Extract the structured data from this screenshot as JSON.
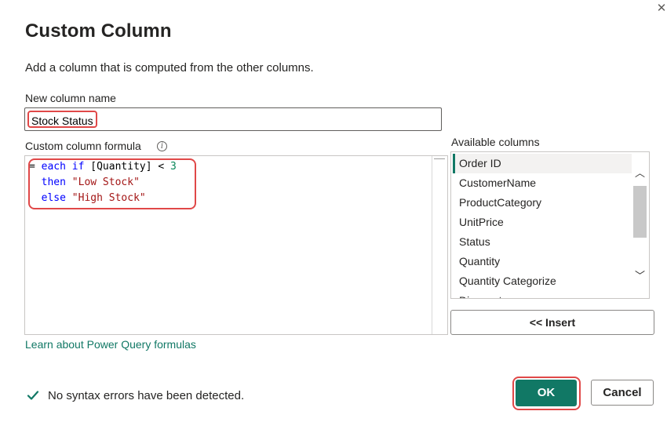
{
  "dialog": {
    "title": "Custom Column",
    "subtitle": "Add a column that is computed from the other columns.",
    "close_symbol": "✕"
  },
  "name_field": {
    "label": "New column name",
    "value": "Stock Status"
  },
  "formula": {
    "label": "Custom column formula",
    "info_icon": "i",
    "lines": [
      [
        {
          "t": "= ",
          "c": "op"
        },
        {
          "t": "each",
          "c": "kw"
        },
        {
          "t": " ",
          "c": "op"
        },
        {
          "t": "if",
          "c": "kw"
        },
        {
          "t": " [Quantity] < ",
          "c": "id"
        },
        {
          "t": "3",
          "c": "num"
        }
      ],
      [
        {
          "t": "  ",
          "c": "op"
        },
        {
          "t": "then",
          "c": "kw"
        },
        {
          "t": " ",
          "c": "op"
        },
        {
          "t": "\"Low Stock\"",
          "c": "str"
        }
      ],
      [
        {
          "t": "  ",
          "c": "op"
        },
        {
          "t": "else",
          "c": "kw"
        },
        {
          "t": " ",
          "c": "op"
        },
        {
          "t": "\"High Stock\"",
          "c": "str"
        }
      ]
    ]
  },
  "available_columns": {
    "label": "Available columns",
    "items": [
      "Order ID",
      "CustomerName",
      "ProductCategory",
      "UnitPrice",
      "Status",
      "Quantity",
      "Quantity Categorize",
      "Discount"
    ],
    "selected": "Order ID",
    "insert_label": "<< Insert",
    "scroll_up": "︿",
    "scroll_down": "﹀"
  },
  "learn_link": "Learn about Power Query formulas",
  "status": {
    "text": "No syntax errors have been detected.",
    "icon": "checkmark-icon",
    "color": "#117865"
  },
  "buttons": {
    "ok": "OK",
    "cancel": "Cancel"
  },
  "colors": {
    "accent": "#117865",
    "highlight": "#e04848"
  }
}
